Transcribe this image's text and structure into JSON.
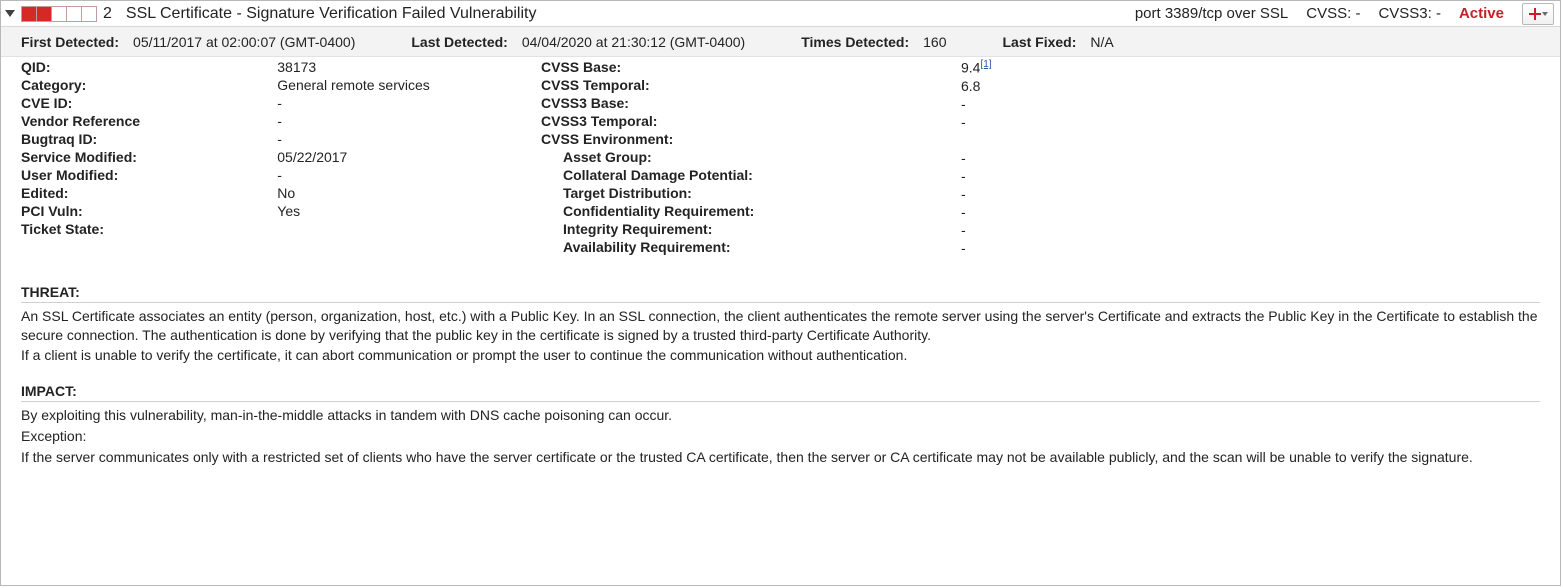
{
  "header": {
    "severity_level": "2",
    "severity_filled": 2,
    "severity_total": 5,
    "title": "SSL Certificate - Signature Verification Failed Vulnerability",
    "port": "port 3389/tcp over SSL",
    "cvss_label": "CVSS:",
    "cvss_value": "-",
    "cvss3_label": "CVSS3:",
    "cvss3_value": "-",
    "status": "Active"
  },
  "detection": {
    "first_detected_label": "First Detected:",
    "first_detected_value": "05/11/2017 at 02:00:07 (GMT-0400)",
    "last_detected_label": "Last Detected:",
    "last_detected_value": "04/04/2020 at 21:30:12 (GMT-0400)",
    "times_detected_label": "Times Detected:",
    "times_detected_value": "160",
    "last_fixed_label": "Last Fixed:",
    "last_fixed_value": "N/A"
  },
  "details_left": {
    "qid_label": "QID:",
    "qid_value": "38173",
    "category_label": "Category:",
    "category_value": "General remote services",
    "cve_label": "CVE ID:",
    "cve_value": "-",
    "vendor_label": "Vendor Reference",
    "vendor_value": "-",
    "bugtraq_label": "Bugtraq ID:",
    "bugtraq_value": "-",
    "svc_mod_label": "Service Modified:",
    "svc_mod_value": "05/22/2017",
    "user_mod_label": "User Modified:",
    "user_mod_value": "-",
    "edited_label": "Edited:",
    "edited_value": "No",
    "pci_label": "PCI Vuln:",
    "pci_value": "Yes",
    "ticket_label": "Ticket State:",
    "ticket_value": ""
  },
  "details_right": {
    "cvss_base_label": "CVSS Base:",
    "cvss_base_value": "9.4",
    "cvss_base_ref": "[1]",
    "cvss_temporal_label": "CVSS Temporal:",
    "cvss_temporal_value": "6.8",
    "cvss3_base_label": "CVSS3 Base:",
    "cvss3_base_value": "-",
    "cvss3_temporal_label": "CVSS3 Temporal:",
    "cvss3_temporal_value": "-",
    "cvss_env_label": "CVSS Environment:",
    "asset_group_label": "Asset Group:",
    "asset_group_value": "-",
    "collateral_label": "Collateral Damage Potential:",
    "collateral_value": "-",
    "target_label": "Target Distribution:",
    "target_value": "-",
    "conf_label": "Confidentiality Requirement:",
    "conf_value": "-",
    "integ_label": "Integrity Requirement:",
    "integ_value": "-",
    "avail_label": "Availability Requirement:",
    "avail_value": "-"
  },
  "threat": {
    "label": "THREAT:",
    "line1": "An SSL Certificate associates an entity (person, organization, host, etc.) with a Public Key. In an SSL connection, the client authenticates the remote server using the server's Certificate and extracts the Public Key in the Certificate to establish the secure connection. The authentication is done by verifying that the public key in the certificate is signed by a trusted third-party Certificate Authority.",
    "line2": "If a client is unable to verify the certificate, it can abort communication or prompt the user to continue the communication without authentication."
  },
  "impact": {
    "label": "IMPACT:",
    "line1": "By exploiting this vulnerability, man-in-the-middle attacks in tandem with DNS cache poisoning can occur.",
    "line2": "Exception:",
    "line3": "If the server communicates only with a restricted set of clients who have the server certificate or the trusted CA certificate, then the server or CA certificate may not be available publicly, and the scan will be unable to verify the signature."
  }
}
